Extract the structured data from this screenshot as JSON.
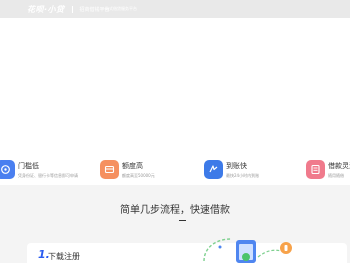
{
  "header": {
    "logo": "花呗·小贷",
    "subtitle": "招商借钱平台",
    "tagline": "一站式借贷服务平台"
  },
  "features": [
    {
      "title": "门槛低",
      "desc": "凭身份证、银行卡等信息即可申请",
      "color": "#4a7ff0"
    },
    {
      "title": "额度高",
      "desc": "额度高至50000元",
      "color": "#f59060"
    },
    {
      "title": "到账快",
      "desc": "最快24小时内到账",
      "color": "#3d7ae8"
    },
    {
      "title": "借款灵活",
      "desc": "随用随借",
      "color": "#f07a8c"
    }
  ],
  "steps": {
    "title": "简单几步流程，快速借款",
    "items": [
      {
        "number": "1.",
        "label": "下载注册"
      }
    ]
  },
  "colors": {
    "accent": "#2a5cf0",
    "section_bg": "#f4f4f4",
    "topbar_bg": "#e9e9e9"
  }
}
